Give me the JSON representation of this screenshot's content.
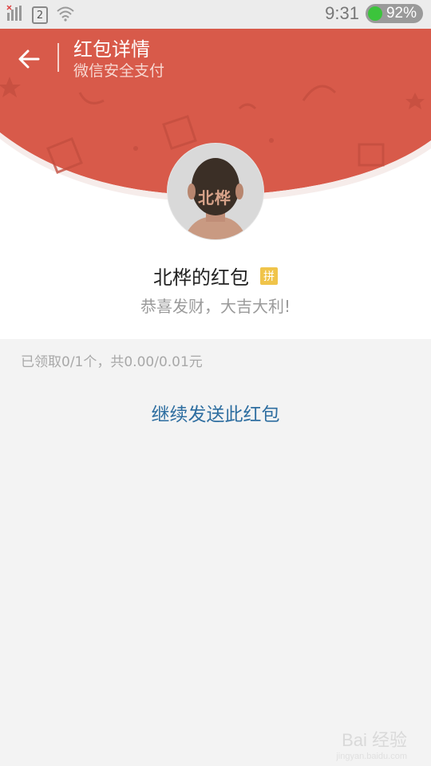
{
  "status_bar": {
    "sim_slot": "2",
    "time": "9:31",
    "battery": "92%",
    "icons": [
      "signal-icon",
      "sim-card-icon",
      "wifi-icon",
      "battery-icon"
    ]
  },
  "header": {
    "title": "红包详情",
    "subtitle": "微信安全支付",
    "background_color": "#d85a4a"
  },
  "profile": {
    "avatar_text": "北桦",
    "sender": "北桦的红包",
    "badge": "拼",
    "blessing": "恭喜发财，大吉大利!"
  },
  "summary": "已领取0/1个，共0.00/0.01元",
  "actions": {
    "resend_label": "继续发送此红包"
  },
  "watermark": {
    "brand": "Bai 经验",
    "url": "jingyan.baidu.com"
  }
}
